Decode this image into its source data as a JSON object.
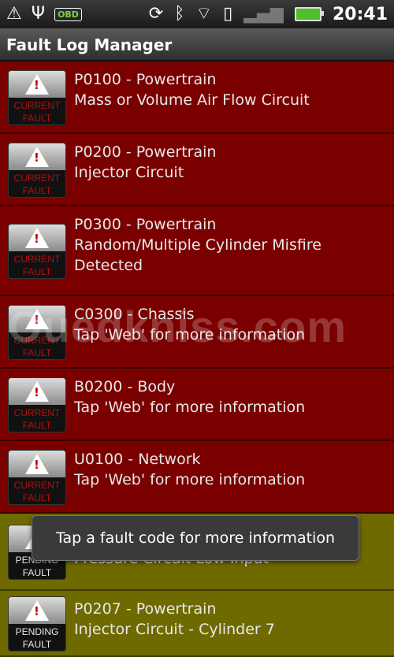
{
  "statusbar": {
    "obd_label": "OBD",
    "time": "20:41",
    "icons": [
      "alert-icon",
      "usb-icon",
      "obd-icon",
      "sync-icon",
      "bluetooth-icon",
      "wifi-icon",
      "sd-icon",
      "signal-icon",
      "battery-icon"
    ]
  },
  "titlebar": {
    "title": "Fault Log Manager"
  },
  "faults": [
    {
      "code": "P0100 - Powertrain",
      "desc": "Mass or Volume Air Flow Circuit",
      "status": "current",
      "badge_line1": "CURRENT",
      "badge_line2": "FAULT"
    },
    {
      "code": "P0200 - Powertrain",
      "desc": "Injector Circuit",
      "status": "current",
      "badge_line1": "CURRENT",
      "badge_line2": "FAULT"
    },
    {
      "code": "P0300 - Powertrain",
      "desc": "Random/Multiple Cylinder Misfire Detected",
      "status": "current",
      "badge_line1": "CURRENT",
      "badge_line2": "FAULT"
    },
    {
      "code": "C0300 - Chassis",
      "desc": "Tap 'Web' for more information",
      "status": "current",
      "badge_line1": "CURRENT",
      "badge_line2": "FAULT"
    },
    {
      "code": "B0200 - Body",
      "desc": "Tap 'Web' for more information",
      "status": "current",
      "badge_line1": "CURRENT",
      "badge_line2": "FAULT"
    },
    {
      "code": "U0100 - Network",
      "desc": "Tap 'Web' for more information",
      "status": "current",
      "badge_line1": "CURRENT",
      "badge_line2": "FAULT"
    },
    {
      "code": "",
      "desc": "Pressure Circuit Low Input",
      "status": "pending",
      "badge_line1": "PENDING",
      "badge_line2": "FAULT"
    },
    {
      "code": "P0207 - Powertrain",
      "desc": "Injector Circuit - Cylinder 7",
      "status": "pending",
      "badge_line1": "PENDING",
      "badge_line2": "FAULT"
    }
  ],
  "toast": {
    "message": "Tap a fault code for more information"
  },
  "watermark": {
    "text": "Ouedkniss.com"
  },
  "colors": {
    "current_bg": "#7a0000",
    "pending_bg": "#6e6a00",
    "titlebar": "#3a3a3a"
  }
}
